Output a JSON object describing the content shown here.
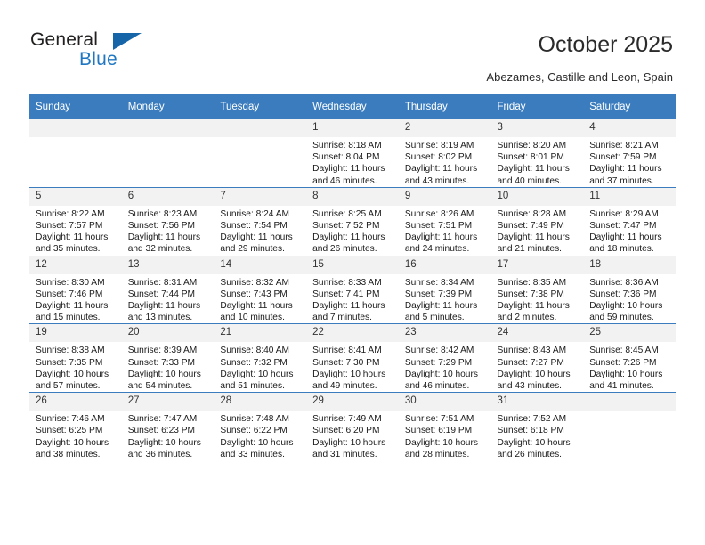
{
  "brand": {
    "name_part1": "General",
    "name_part2": "Blue",
    "triangle_icon": "triangle-icon",
    "accent_color": "#1565a8"
  },
  "header": {
    "title": "October 2025",
    "subtitle": "Abezames, Castille and Leon, Spain"
  },
  "calendar": {
    "header_color": "#3a7cbe",
    "daynum_band_color": "#f2f2f2",
    "weekday_headers": [
      "Sunday",
      "Monday",
      "Tuesday",
      "Wednesday",
      "Thursday",
      "Friday",
      "Saturday"
    ],
    "weeks": [
      [
        {
          "day": "",
          "empty": true,
          "sunrise": "",
          "sunset": "",
          "daylight_line1": "",
          "daylight_line2": ""
        },
        {
          "day": "",
          "empty": true,
          "sunrise": "",
          "sunset": "",
          "daylight_line1": "",
          "daylight_line2": ""
        },
        {
          "day": "",
          "empty": true,
          "sunrise": "",
          "sunset": "",
          "daylight_line1": "",
          "daylight_line2": ""
        },
        {
          "day": "1",
          "empty": false,
          "sunrise": "Sunrise: 8:18 AM",
          "sunset": "Sunset: 8:04 PM",
          "daylight_line1": "Daylight: 11 hours",
          "daylight_line2": "and 46 minutes."
        },
        {
          "day": "2",
          "empty": false,
          "sunrise": "Sunrise: 8:19 AM",
          "sunset": "Sunset: 8:02 PM",
          "daylight_line1": "Daylight: 11 hours",
          "daylight_line2": "and 43 minutes."
        },
        {
          "day": "3",
          "empty": false,
          "sunrise": "Sunrise: 8:20 AM",
          "sunset": "Sunset: 8:01 PM",
          "daylight_line1": "Daylight: 11 hours",
          "daylight_line2": "and 40 minutes."
        },
        {
          "day": "4",
          "empty": false,
          "sunrise": "Sunrise: 8:21 AM",
          "sunset": "Sunset: 7:59 PM",
          "daylight_line1": "Daylight: 11 hours",
          "daylight_line2": "and 37 minutes."
        }
      ],
      [
        {
          "day": "5",
          "empty": false,
          "sunrise": "Sunrise: 8:22 AM",
          "sunset": "Sunset: 7:57 PM",
          "daylight_line1": "Daylight: 11 hours",
          "daylight_line2": "and 35 minutes."
        },
        {
          "day": "6",
          "empty": false,
          "sunrise": "Sunrise: 8:23 AM",
          "sunset": "Sunset: 7:56 PM",
          "daylight_line1": "Daylight: 11 hours",
          "daylight_line2": "and 32 minutes."
        },
        {
          "day": "7",
          "empty": false,
          "sunrise": "Sunrise: 8:24 AM",
          "sunset": "Sunset: 7:54 PM",
          "daylight_line1": "Daylight: 11 hours",
          "daylight_line2": "and 29 minutes."
        },
        {
          "day": "8",
          "empty": false,
          "sunrise": "Sunrise: 8:25 AM",
          "sunset": "Sunset: 7:52 PM",
          "daylight_line1": "Daylight: 11 hours",
          "daylight_line2": "and 26 minutes."
        },
        {
          "day": "9",
          "empty": false,
          "sunrise": "Sunrise: 8:26 AM",
          "sunset": "Sunset: 7:51 PM",
          "daylight_line1": "Daylight: 11 hours",
          "daylight_line2": "and 24 minutes."
        },
        {
          "day": "10",
          "empty": false,
          "sunrise": "Sunrise: 8:28 AM",
          "sunset": "Sunset: 7:49 PM",
          "daylight_line1": "Daylight: 11 hours",
          "daylight_line2": "and 21 minutes."
        },
        {
          "day": "11",
          "empty": false,
          "sunrise": "Sunrise: 8:29 AM",
          "sunset": "Sunset: 7:47 PM",
          "daylight_line1": "Daylight: 11 hours",
          "daylight_line2": "and 18 minutes."
        }
      ],
      [
        {
          "day": "12",
          "empty": false,
          "sunrise": "Sunrise: 8:30 AM",
          "sunset": "Sunset: 7:46 PM",
          "daylight_line1": "Daylight: 11 hours",
          "daylight_line2": "and 15 minutes."
        },
        {
          "day": "13",
          "empty": false,
          "sunrise": "Sunrise: 8:31 AM",
          "sunset": "Sunset: 7:44 PM",
          "daylight_line1": "Daylight: 11 hours",
          "daylight_line2": "and 13 minutes."
        },
        {
          "day": "14",
          "empty": false,
          "sunrise": "Sunrise: 8:32 AM",
          "sunset": "Sunset: 7:43 PM",
          "daylight_line1": "Daylight: 11 hours",
          "daylight_line2": "and 10 minutes."
        },
        {
          "day": "15",
          "empty": false,
          "sunrise": "Sunrise: 8:33 AM",
          "sunset": "Sunset: 7:41 PM",
          "daylight_line1": "Daylight: 11 hours",
          "daylight_line2": "and 7 minutes."
        },
        {
          "day": "16",
          "empty": false,
          "sunrise": "Sunrise: 8:34 AM",
          "sunset": "Sunset: 7:39 PM",
          "daylight_line1": "Daylight: 11 hours",
          "daylight_line2": "and 5 minutes."
        },
        {
          "day": "17",
          "empty": false,
          "sunrise": "Sunrise: 8:35 AM",
          "sunset": "Sunset: 7:38 PM",
          "daylight_line1": "Daylight: 11 hours",
          "daylight_line2": "and 2 minutes."
        },
        {
          "day": "18",
          "empty": false,
          "sunrise": "Sunrise: 8:36 AM",
          "sunset": "Sunset: 7:36 PM",
          "daylight_line1": "Daylight: 10 hours",
          "daylight_line2": "and 59 minutes."
        }
      ],
      [
        {
          "day": "19",
          "empty": false,
          "sunrise": "Sunrise: 8:38 AM",
          "sunset": "Sunset: 7:35 PM",
          "daylight_line1": "Daylight: 10 hours",
          "daylight_line2": "and 57 minutes."
        },
        {
          "day": "20",
          "empty": false,
          "sunrise": "Sunrise: 8:39 AM",
          "sunset": "Sunset: 7:33 PM",
          "daylight_line1": "Daylight: 10 hours",
          "daylight_line2": "and 54 minutes."
        },
        {
          "day": "21",
          "empty": false,
          "sunrise": "Sunrise: 8:40 AM",
          "sunset": "Sunset: 7:32 PM",
          "daylight_line1": "Daylight: 10 hours",
          "daylight_line2": "and 51 minutes."
        },
        {
          "day": "22",
          "empty": false,
          "sunrise": "Sunrise: 8:41 AM",
          "sunset": "Sunset: 7:30 PM",
          "daylight_line1": "Daylight: 10 hours",
          "daylight_line2": "and 49 minutes."
        },
        {
          "day": "23",
          "empty": false,
          "sunrise": "Sunrise: 8:42 AM",
          "sunset": "Sunset: 7:29 PM",
          "daylight_line1": "Daylight: 10 hours",
          "daylight_line2": "and 46 minutes."
        },
        {
          "day": "24",
          "empty": false,
          "sunrise": "Sunrise: 8:43 AM",
          "sunset": "Sunset: 7:27 PM",
          "daylight_line1": "Daylight: 10 hours",
          "daylight_line2": "and 43 minutes."
        },
        {
          "day": "25",
          "empty": false,
          "sunrise": "Sunrise: 8:45 AM",
          "sunset": "Sunset: 7:26 PM",
          "daylight_line1": "Daylight: 10 hours",
          "daylight_line2": "and 41 minutes."
        }
      ],
      [
        {
          "day": "26",
          "empty": false,
          "sunrise": "Sunrise: 7:46 AM",
          "sunset": "Sunset: 6:25 PM",
          "daylight_line1": "Daylight: 10 hours",
          "daylight_line2": "and 38 minutes."
        },
        {
          "day": "27",
          "empty": false,
          "sunrise": "Sunrise: 7:47 AM",
          "sunset": "Sunset: 6:23 PM",
          "daylight_line1": "Daylight: 10 hours",
          "daylight_line2": "and 36 minutes."
        },
        {
          "day": "28",
          "empty": false,
          "sunrise": "Sunrise: 7:48 AM",
          "sunset": "Sunset: 6:22 PM",
          "daylight_line1": "Daylight: 10 hours",
          "daylight_line2": "and 33 minutes."
        },
        {
          "day": "29",
          "empty": false,
          "sunrise": "Sunrise: 7:49 AM",
          "sunset": "Sunset: 6:20 PM",
          "daylight_line1": "Daylight: 10 hours",
          "daylight_line2": "and 31 minutes."
        },
        {
          "day": "30",
          "empty": false,
          "sunrise": "Sunrise: 7:51 AM",
          "sunset": "Sunset: 6:19 PM",
          "daylight_line1": "Daylight: 10 hours",
          "daylight_line2": "and 28 minutes."
        },
        {
          "day": "31",
          "empty": false,
          "sunrise": "Sunrise: 7:52 AM",
          "sunset": "Sunset: 6:18 PM",
          "daylight_line1": "Daylight: 10 hours",
          "daylight_line2": "and 26 minutes."
        },
        {
          "day": "",
          "empty": true,
          "sunrise": "",
          "sunset": "",
          "daylight_line1": "",
          "daylight_line2": ""
        }
      ]
    ]
  }
}
